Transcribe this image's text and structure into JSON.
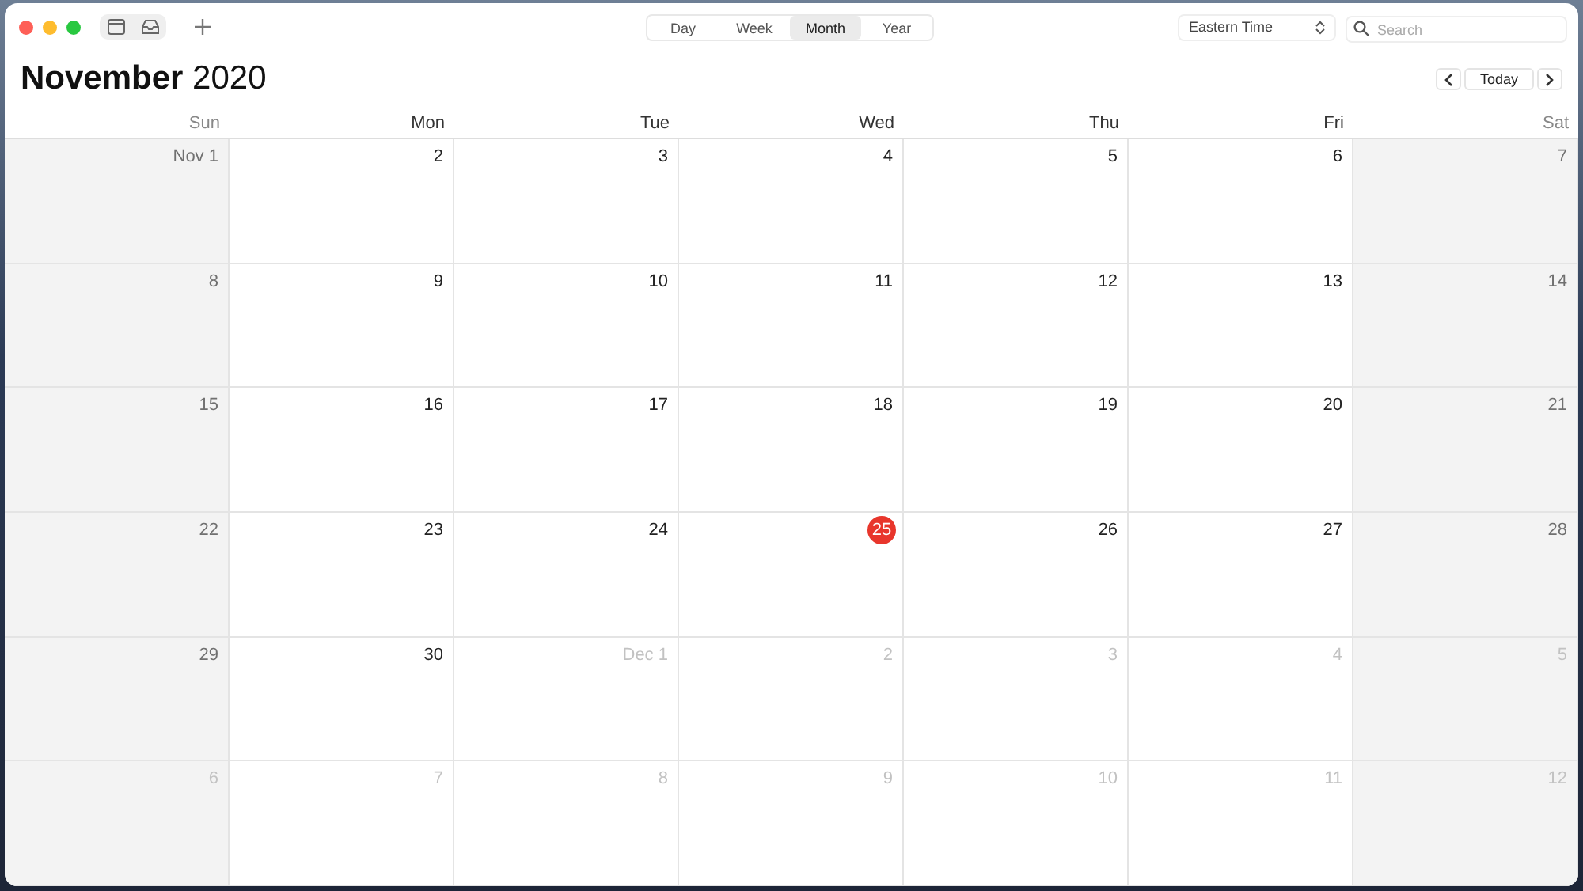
{
  "toolbar": {
    "views": [
      {
        "label": "Day",
        "selected": false
      },
      {
        "label": "Week",
        "selected": false
      },
      {
        "label": "Month",
        "selected": true
      },
      {
        "label": "Year",
        "selected": false
      }
    ],
    "timezone": "Eastern Time",
    "search": {
      "placeholder": "Search"
    }
  },
  "header": {
    "month": "November",
    "year": "2020",
    "today_button": "Today"
  },
  "weekdays": [
    {
      "label": "Sun",
      "weekend": true
    },
    {
      "label": "Mon",
      "weekend": false
    },
    {
      "label": "Tue",
      "weekend": false
    },
    {
      "label": "Wed",
      "weekend": false
    },
    {
      "label": "Thu",
      "weekend": false
    },
    {
      "label": "Fri",
      "weekend": false
    },
    {
      "label": "Sat",
      "weekend": true
    }
  ],
  "weeks": [
    [
      {
        "label": "Nov 1",
        "outside": false,
        "today": false
      },
      {
        "label": "2",
        "outside": false,
        "today": false
      },
      {
        "label": "3",
        "outside": false,
        "today": false
      },
      {
        "label": "4",
        "outside": false,
        "today": false
      },
      {
        "label": "5",
        "outside": false,
        "today": false
      },
      {
        "label": "6",
        "outside": false,
        "today": false
      },
      {
        "label": "7",
        "outside": false,
        "today": false
      }
    ],
    [
      {
        "label": "8",
        "outside": false,
        "today": false
      },
      {
        "label": "9",
        "outside": false,
        "today": false
      },
      {
        "label": "10",
        "outside": false,
        "today": false
      },
      {
        "label": "11",
        "outside": false,
        "today": false
      },
      {
        "label": "12",
        "outside": false,
        "today": false
      },
      {
        "label": "13",
        "outside": false,
        "today": false
      },
      {
        "label": "14",
        "outside": false,
        "today": false
      }
    ],
    [
      {
        "label": "15",
        "outside": false,
        "today": false
      },
      {
        "label": "16",
        "outside": false,
        "today": false
      },
      {
        "label": "17",
        "outside": false,
        "today": false
      },
      {
        "label": "18",
        "outside": false,
        "today": false
      },
      {
        "label": "19",
        "outside": false,
        "today": false
      },
      {
        "label": "20",
        "outside": false,
        "today": false
      },
      {
        "label": "21",
        "outside": false,
        "today": false
      }
    ],
    [
      {
        "label": "22",
        "outside": false,
        "today": false
      },
      {
        "label": "23",
        "outside": false,
        "today": false
      },
      {
        "label": "24",
        "outside": false,
        "today": false
      },
      {
        "label": "25",
        "outside": false,
        "today": true
      },
      {
        "label": "26",
        "outside": false,
        "today": false
      },
      {
        "label": "27",
        "outside": false,
        "today": false
      },
      {
        "label": "28",
        "outside": false,
        "today": false
      }
    ],
    [
      {
        "label": "29",
        "outside": false,
        "today": false
      },
      {
        "label": "30",
        "outside": false,
        "today": false
      },
      {
        "label": "Dec 1",
        "outside": true,
        "today": false
      },
      {
        "label": "2",
        "outside": true,
        "today": false
      },
      {
        "label": "3",
        "outside": true,
        "today": false
      },
      {
        "label": "4",
        "outside": true,
        "today": false
      },
      {
        "label": "5",
        "outside": true,
        "today": false
      }
    ],
    [
      {
        "label": "6",
        "outside": true,
        "today": false
      },
      {
        "label": "7",
        "outside": true,
        "today": false
      },
      {
        "label": "8",
        "outside": true,
        "today": false
      },
      {
        "label": "9",
        "outside": true,
        "today": false
      },
      {
        "label": "10",
        "outside": true,
        "today": false
      },
      {
        "label": "11",
        "outside": true,
        "today": false
      },
      {
        "label": "12",
        "outside": true,
        "today": false
      }
    ]
  ]
}
